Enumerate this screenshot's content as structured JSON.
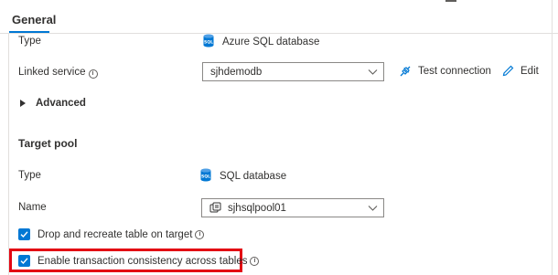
{
  "tabs": {
    "active": "General"
  },
  "type_row": {
    "label": "Type",
    "value": "Azure SQL database",
    "icon": "sql-database-icon"
  },
  "linked_service": {
    "label": "Linked service",
    "selected": "sjhdemodb",
    "test_connection": "Test connection",
    "edit": "Edit"
  },
  "advanced": {
    "label": "Advanced"
  },
  "target_pool": {
    "title": "Target pool",
    "type_label": "Type",
    "type_value": "SQL database",
    "name_label": "Name",
    "name_selected": "sjhsqlpool01"
  },
  "options": {
    "drop_recreate": {
      "label": "Drop and recreate table on target",
      "checked": true
    },
    "transaction_consistency": {
      "label": "Enable transaction consistency across tables",
      "checked": true
    }
  },
  "colors": {
    "accent": "#0078d4",
    "highlight": "#e30613",
    "sql_icon": "#0078d4"
  }
}
